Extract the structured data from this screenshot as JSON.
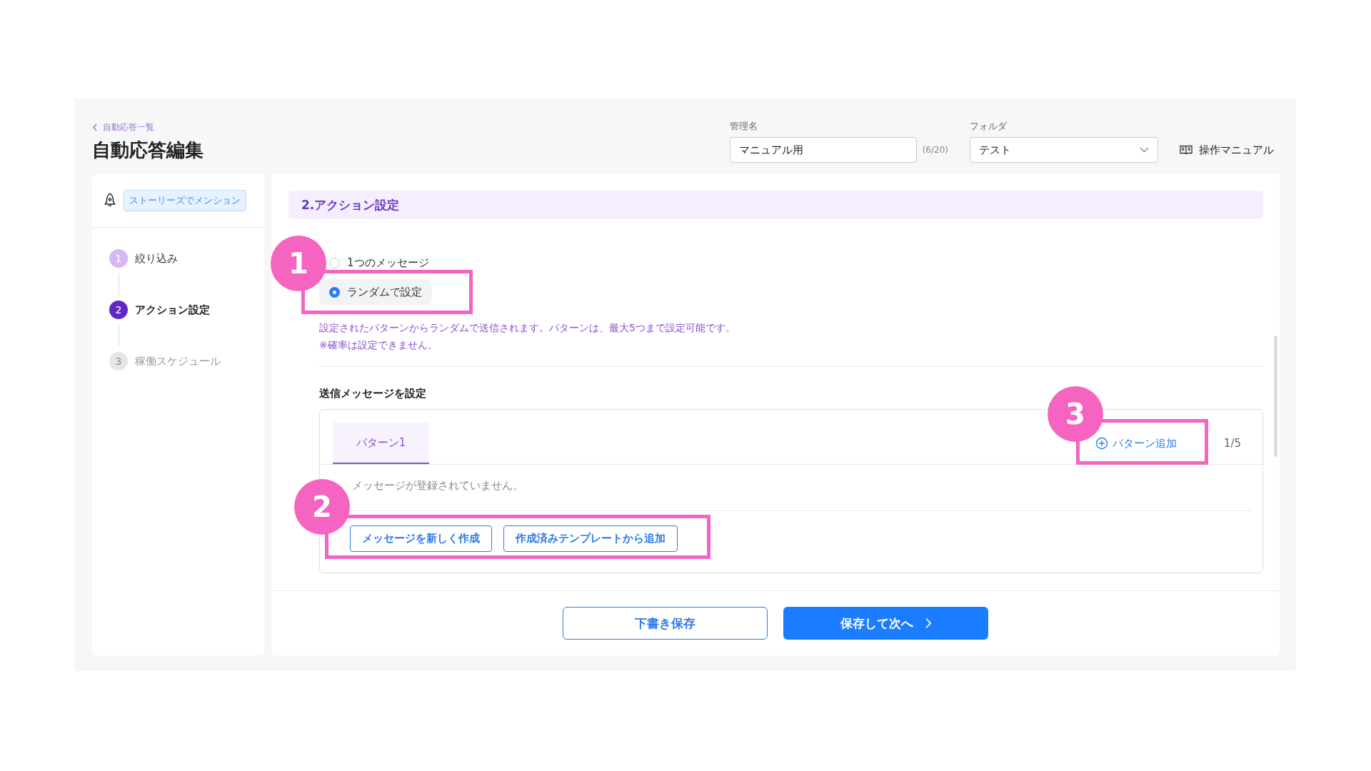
{
  "breadcrumb": {
    "label": "自動応答一覧"
  },
  "page_title": "自動応答編集",
  "name_field": {
    "label": "管理名",
    "value": "マニュアル用",
    "counter": "(6/20)"
  },
  "folder_field": {
    "label": "フォルダ",
    "value": "テスト"
  },
  "manual_link": {
    "label": "操作マニュアル"
  },
  "sidebar": {
    "trigger_tag": "ストーリーズでメンション",
    "steps": [
      {
        "number": "1",
        "label": "絞り込み",
        "completed": true,
        "selected": false
      },
      {
        "number": "2",
        "label": "アクション設定",
        "completed": false,
        "selected": true
      },
      {
        "number": "3",
        "label": "稼働スケジュール",
        "completed": false,
        "selected": false
      }
    ]
  },
  "section": {
    "title": "2.アクション設定",
    "options": [
      {
        "label": "1つのメッセージ",
        "selected": false
      },
      {
        "label": "ランダムで設定",
        "selected": true
      }
    ],
    "description": [
      "設定されたパターンからランダムで送信されます。パターンは、最大5つまで設定可能です。",
      "※確率は設定できません。"
    ],
    "messages": {
      "title": "送信メッセージを設定",
      "tabs": [
        {
          "label": "パターン1",
          "selected": true
        }
      ],
      "add_pattern": "パターン追加",
      "count": "1/5",
      "empty": "メッセージが登録されていません。",
      "buttons": [
        "メッセージを新しく作成",
        "作成済みテンプレートから追加"
      ]
    }
  },
  "footer": {
    "buttons": [
      {
        "label": "下書き保存",
        "kind": "secondary"
      },
      {
        "label": "保存して次へ",
        "kind": "primary"
      }
    ]
  },
  "annotations": [
    {
      "label": "1"
    },
    {
      "label": "2"
    },
    {
      "label": "3"
    }
  ]
}
